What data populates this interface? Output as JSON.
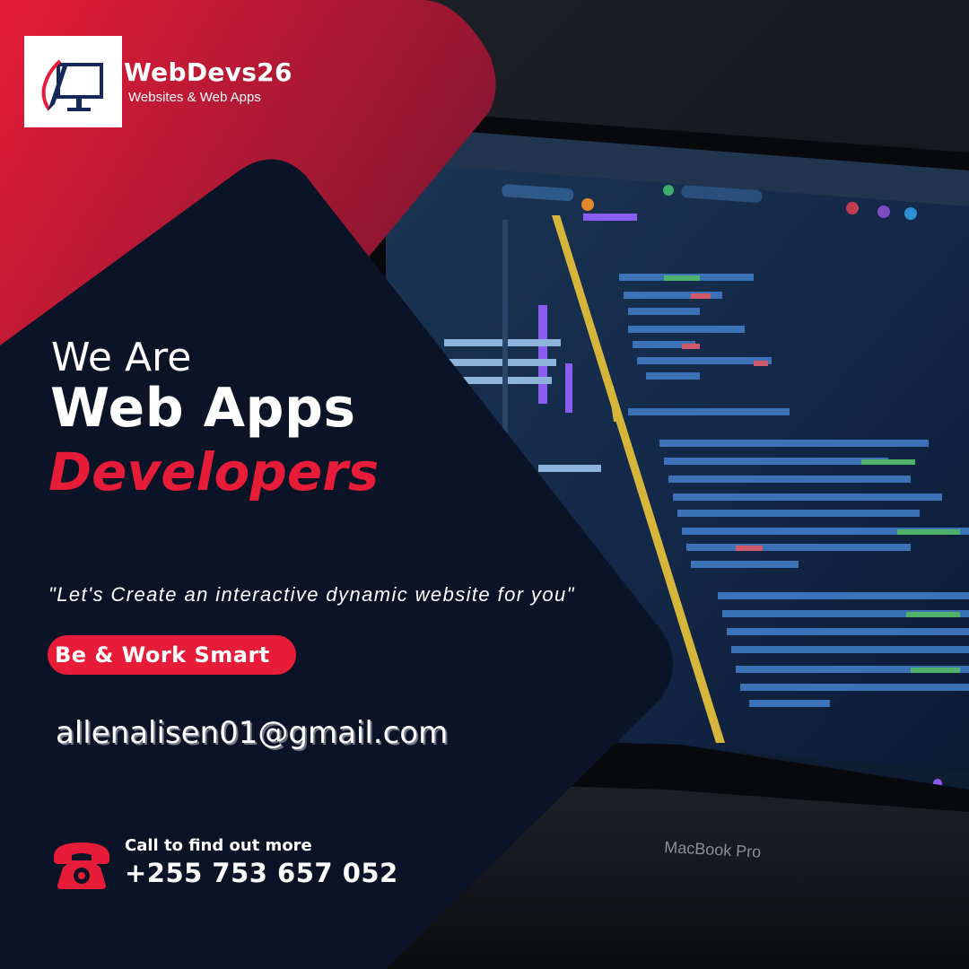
{
  "brand": {
    "name": "WebDevs26",
    "tagline": "Websites & Web Apps",
    "logo_icon": "monitor-pen-icon"
  },
  "headline": {
    "line1": "We Are",
    "line2": "Web Apps",
    "line3": "Developers"
  },
  "quote": "\"Let's Create an interactive dynamic website for you\"",
  "cta_label": "Be & Work Smart",
  "email": "allenalisen01@gmail.com",
  "call": {
    "label": "Call to find out more",
    "number": "+255 753 657 052",
    "icon": "phone-icon"
  },
  "background": {
    "laptop_brand": "MacBook Pro"
  },
  "colors": {
    "accent_red": "#e61c38",
    "navy": "#0b1326"
  }
}
